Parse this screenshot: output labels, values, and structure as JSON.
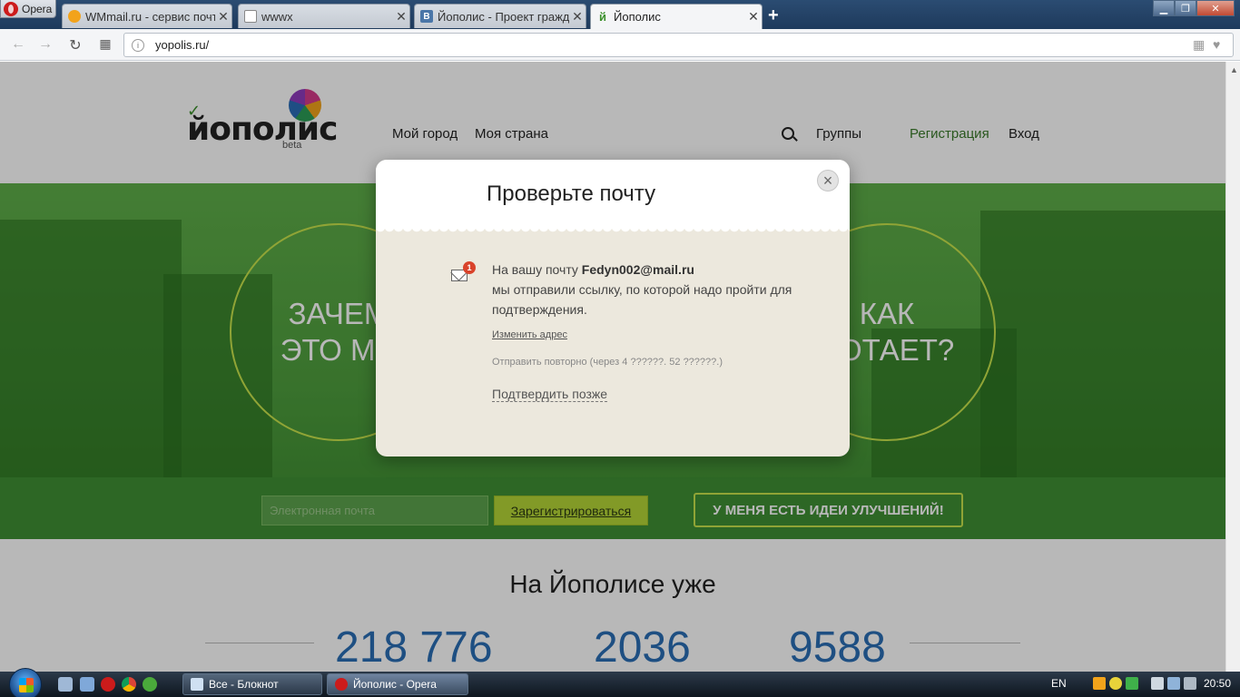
{
  "browser": {
    "menu_label": "Opera",
    "tabs": [
      {
        "label": "WMmail.ru - сервис почт",
        "favicon": "wmmail-icon"
      },
      {
        "label": "wwwx",
        "favicon": "page-icon"
      },
      {
        "label": "Йополис - Проект гражд",
        "favicon": "vk-icon"
      },
      {
        "label": "Йополис",
        "favicon": "yopolis-icon"
      }
    ],
    "new_tab": "+",
    "address": "yopolis.ru/"
  },
  "site": {
    "logo_text": "йополис",
    "logo_beta": "beta",
    "nav": {
      "my_city": "Мой город",
      "my_country": "Моя страна",
      "groups": "Группы",
      "register": "Регистрация",
      "login": "Вход"
    },
    "hero": {
      "left_line1": "ЗАЧЕМ",
      "left_line2": "ЭТО МН",
      "right_line1": "КАК",
      "right_line2": "БОТАЕТ?"
    },
    "email_placeholder": "Электронная почта",
    "register_button": "Зарегистрироваться",
    "ideas_button": "У МЕНЯ ЕСТЬ ИДЕИ УЛУЧШЕНИЙ!",
    "stats_title": "На Йополисе уже",
    "stats": [
      "218 776",
      "2036",
      "9588"
    ]
  },
  "modal": {
    "title": "Проверьте почту",
    "close": "×",
    "badge": "1",
    "msg_prefix": "На вашу почту ",
    "email": "Fedyn002@mail.ru",
    "msg_rest": "мы отправили ссылку, по которой надо пройти для подтверждения.",
    "change_address": "Изменить адрес",
    "resend": "Отправить повторно (через 4 ??????. 52 ??????.)",
    "confirm_later": "Подтвердить позже"
  },
  "taskbar": {
    "tasks": [
      "Все - Блокнот",
      "Йополис - Opera"
    ],
    "lang": "EN",
    "time": "20:50"
  },
  "colors": {
    "accent_green": "#b5d637",
    "link_green": "#3a7a2a",
    "stat_blue": "#2a6eb5"
  }
}
